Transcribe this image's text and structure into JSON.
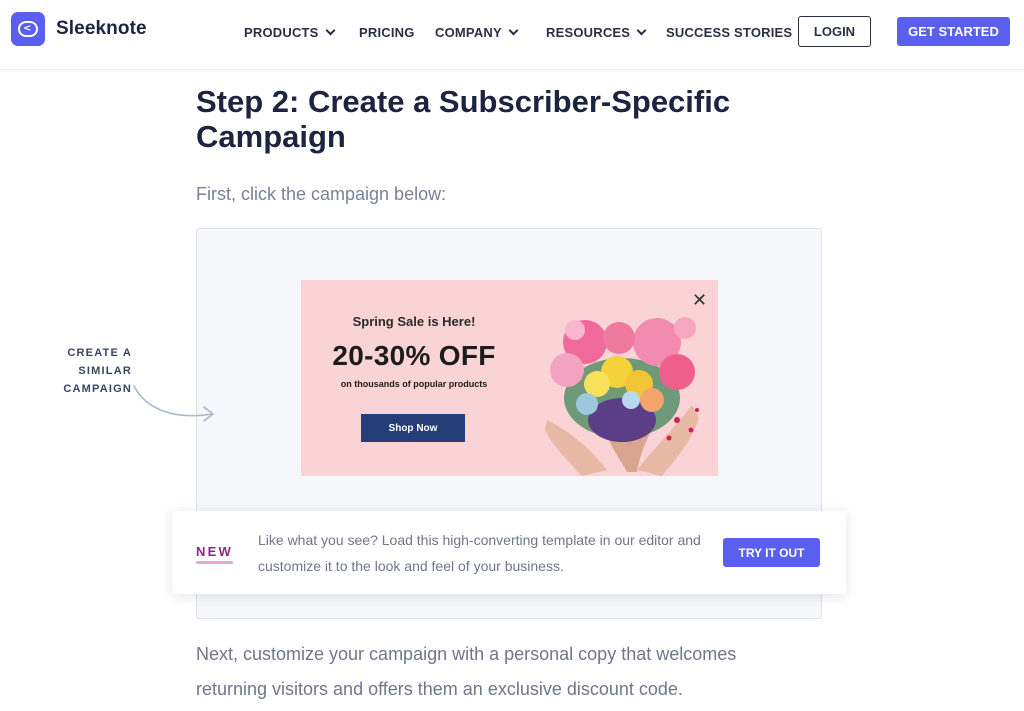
{
  "brand": {
    "name": "Sleeknote",
    "accent": "#5b5ff0"
  },
  "nav": {
    "items": [
      {
        "label": "PRODUCTS",
        "dropdown": true
      },
      {
        "label": "PRICING",
        "dropdown": false
      },
      {
        "label": "COMPANY",
        "dropdown": true
      },
      {
        "label": "RESOURCES",
        "dropdown": true
      },
      {
        "label": "SUCCESS STORIES",
        "dropdown": false
      }
    ],
    "login_label": "LOGIN",
    "get_started_label": "GET STARTED"
  },
  "article": {
    "title": "Step 2: Create a Subscriber-Specific Campaign",
    "intro": "First, click the campaign below:",
    "next_paragraph": "Next, customize your campaign with a personal copy that welcomes returning visitors and offers them an exclusive discount code."
  },
  "side_cta": {
    "text": "CREATE A SIMILAR CAMPAIGN"
  },
  "popup": {
    "kicker": "Spring Sale is Here!",
    "headline": "20-30% OFF",
    "subline": "on thousands of popular products",
    "button_label": "Shop Now",
    "close_glyph": "✕",
    "background_color": "#f9d3d6",
    "button_color": "#243d77",
    "image_icon": "flower-heart-hands-image"
  },
  "banner": {
    "badge": "NEW",
    "text": "Like what you see? Load this high-converting template in our editor and customize it to the look and feel of your business.",
    "button_label": "TRY IT OUT"
  }
}
